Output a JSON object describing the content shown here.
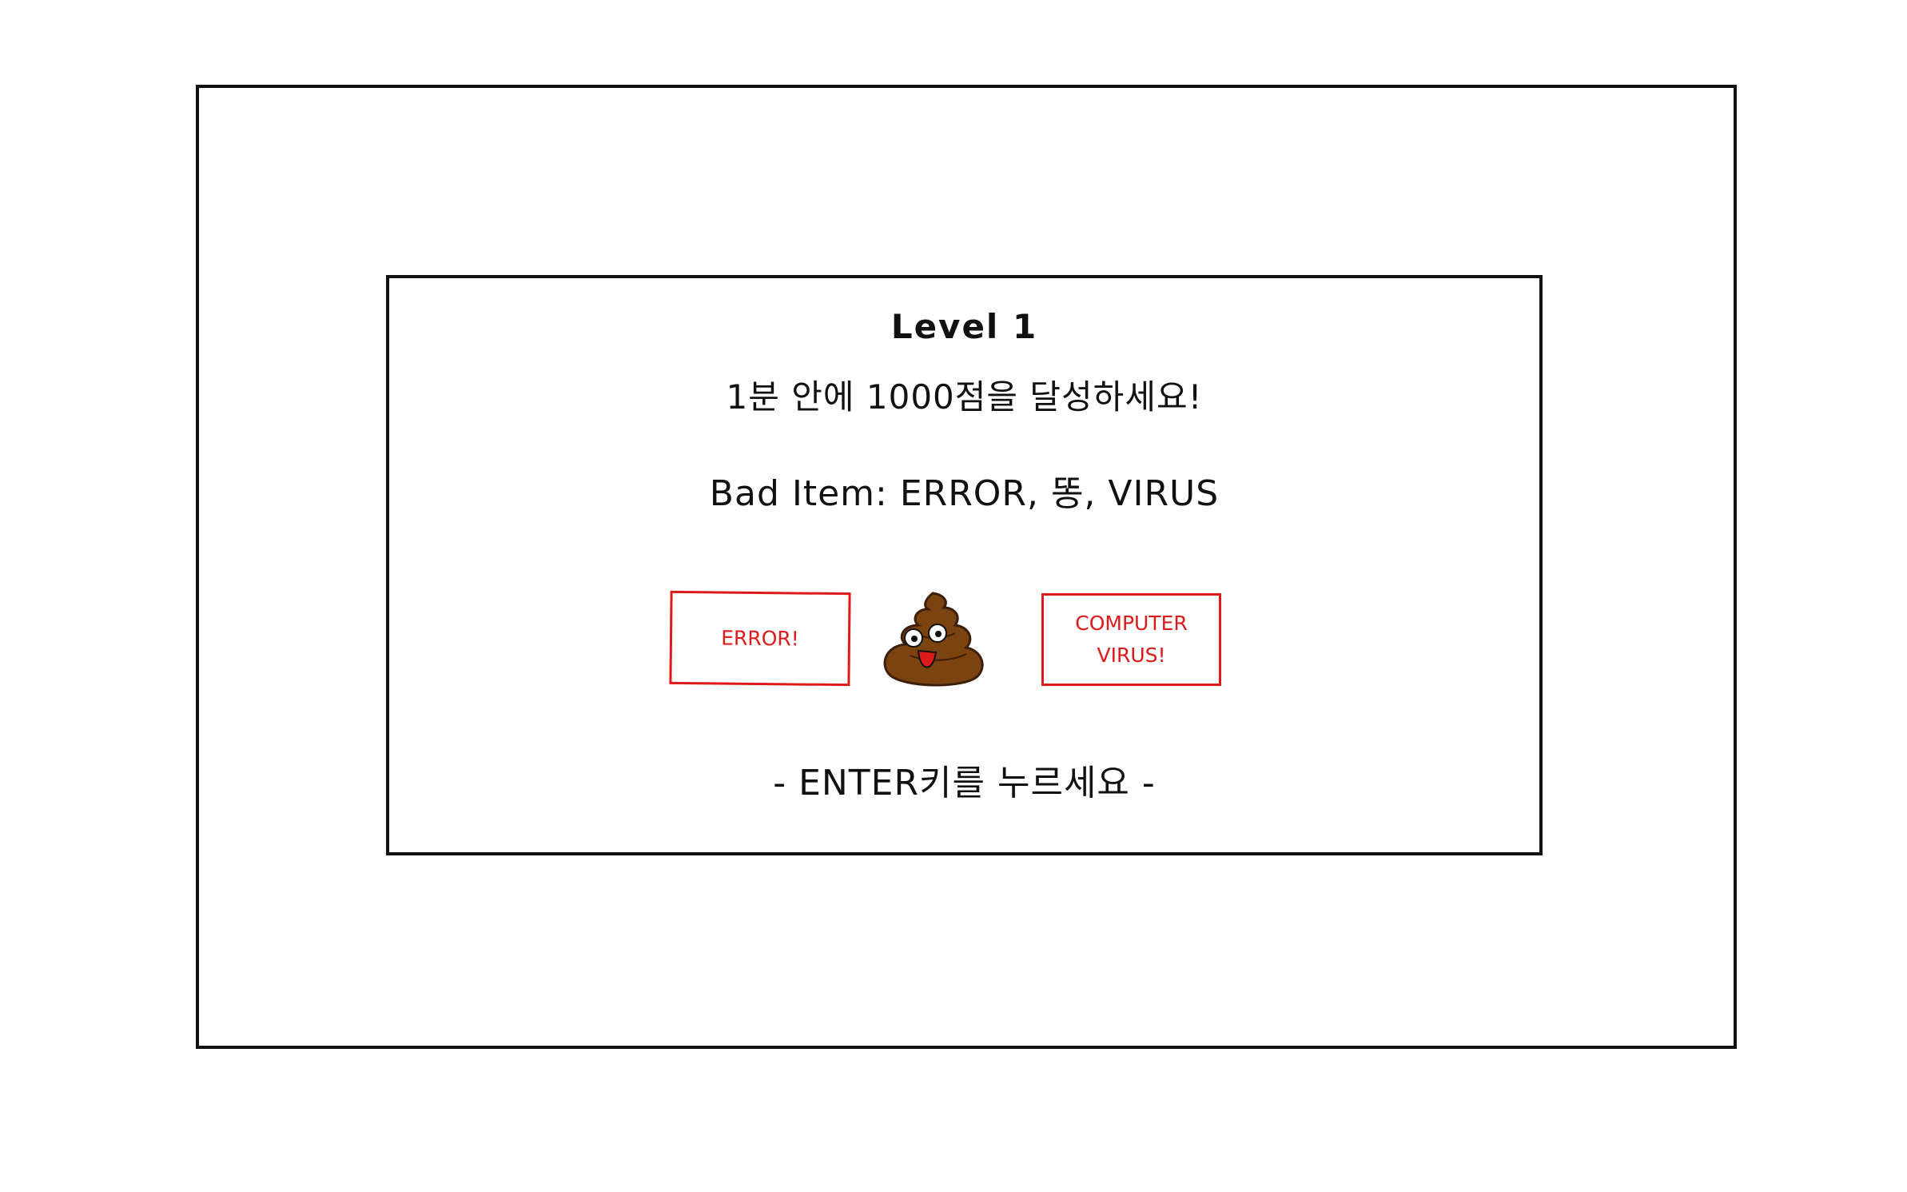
{
  "dialog": {
    "level_title": "Level 1",
    "goal_text": "1분 안에 1000점을 달성하세요!",
    "bad_items_text": "Bad Item: ERROR, 똥, VIRUS",
    "enter_prompt": "- ENTER키를 누르세요 -"
  },
  "items": {
    "error_label": "ERROR!",
    "virus_label_line1": "COMPUTER",
    "virus_label_line2": "VIRUS!",
    "poop_icon": "poop-icon"
  },
  "colors": {
    "border": "#111111",
    "item_red": "#dd1a1a",
    "poop_brown": "#7a4310"
  }
}
